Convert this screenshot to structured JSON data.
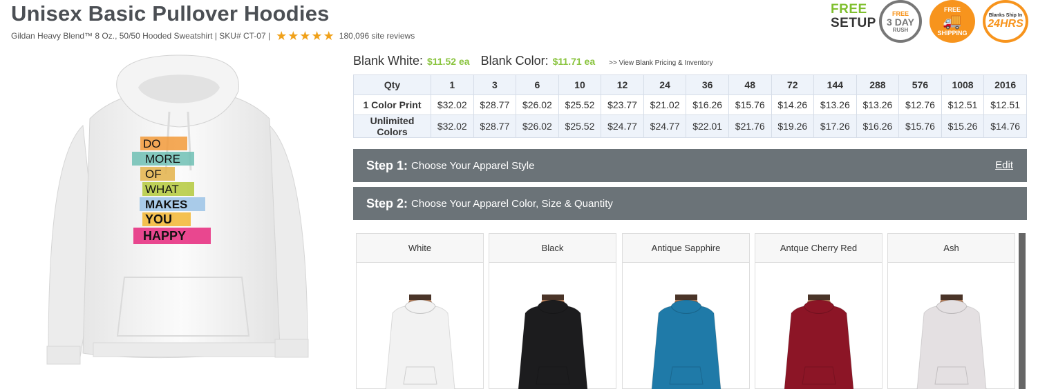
{
  "product": {
    "title": "Unisex Basic Pullover Hoodies",
    "subtitle": "Gildan Heavy Blend™ 8 Oz., 50/50 Hooded Sweatshirt | SKU# CT-07 |",
    "reviews": "180,096 site reviews",
    "rating_stars": 5
  },
  "badges": {
    "free": "FREE",
    "setup": "SETUP",
    "rush_free": "FREE",
    "rush_days": "3 DAY",
    "rush": "RUSH",
    "shipping_free": "FREE",
    "shipping": "SHIPPING",
    "blanks_ship_in": "Blanks Ship In",
    "hrs": "24HRS"
  },
  "design": {
    "lines": [
      "DO",
      "MORE",
      "OF",
      "WHAT",
      "MAKES",
      "YOU",
      "HAPPY"
    ]
  },
  "blank_pricing": {
    "white_label": "Blank White:",
    "white_price": "$11.52 ea",
    "color_label": "Blank Color:",
    "color_price": "$11.71 ea",
    "link": ">> View Blank Pricing & Inventory"
  },
  "price_table": {
    "header": [
      "Qty",
      "1",
      "3",
      "6",
      "10",
      "12",
      "24",
      "36",
      "48",
      "72",
      "144",
      "288",
      "576",
      "1008",
      "2016"
    ],
    "rows": [
      {
        "label": "1 Color Print",
        "values": [
          "$32.02",
          "$28.77",
          "$26.02",
          "$25.52",
          "$23.77",
          "$21.02",
          "$16.26",
          "$15.76",
          "$14.26",
          "$13.26",
          "$13.26",
          "$12.76",
          "$12.51",
          "$12.51"
        ]
      },
      {
        "label": "Unlimited Colors",
        "values": [
          "$32.02",
          "$28.77",
          "$26.02",
          "$25.52",
          "$24.77",
          "$24.77",
          "$22.01",
          "$21.76",
          "$19.26",
          "$17.26",
          "$16.26",
          "$15.76",
          "$15.26",
          "$14.76"
        ]
      }
    ]
  },
  "steps": [
    {
      "num": "Step 1:",
      "text": "Choose Your Apparel Style",
      "action": "Edit"
    },
    {
      "num": "Step 2:",
      "text": "Choose Your Apparel Color, Size & Quantity"
    }
  ],
  "colors": [
    {
      "name": "White",
      "hex": "#f2f2f2"
    },
    {
      "name": "Black",
      "hex": "#1c1c1e"
    },
    {
      "name": "Antique Sapphire",
      "hex": "#1f7aa8"
    },
    {
      "name": "Antque Cherry Red",
      "hex": "#8c1526"
    },
    {
      "name": "Ash",
      "hex": "#e4e0e2"
    }
  ]
}
